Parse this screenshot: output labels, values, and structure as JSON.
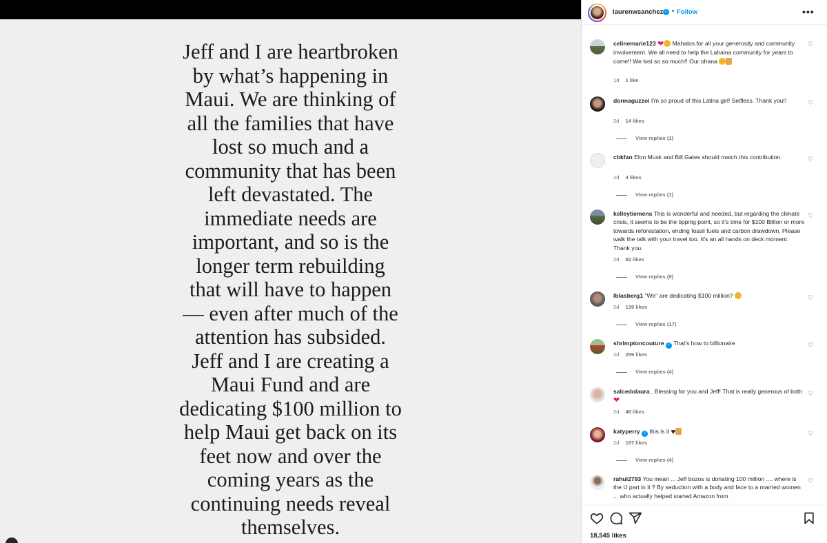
{
  "media": {
    "lines": [
      "Jeff and I are heartbroken",
      "by what’s happening in",
      "Maui. We are thinking of",
      "all the families that have",
      "lost so much and a",
      "community that has been",
      "left devastated. The",
      "immediate needs are",
      "important, and so is the",
      "longer term rebuilding",
      "that will have to happen",
      "— even after much of the",
      "attention has subsided.",
      "Jeff and I are creating a",
      "Maui Fund and are",
      "dedicating $100 million to",
      "help Maui get back on its",
      "feet now and over the",
      "coming years as the",
      "continuing needs reveal",
      "themselves."
    ]
  },
  "header": {
    "username": "laurenwsanchez",
    "dot": "•",
    "follow_label": "Follow",
    "more_label": "•••"
  },
  "comments": [
    {
      "user": "celinemarie123",
      "text": "Mahalos for all your generosity and community involvement. We all need to help the Lahaina community for years to come!! We lost so so much!! Our ohana",
      "age": "1d",
      "likes": "1 like",
      "replies": ""
    },
    {
      "user": "donnaguzzoi",
      "text": "I'm so proud of this Latina girl! Selfless. Thank you!!",
      "age": "2d",
      "likes": "14 likes",
      "replies": "View replies (1)"
    },
    {
      "user": "cbkfan",
      "text": "Elon Musk and Bill Gates should match this contribution.",
      "age": "2d",
      "likes": "4 likes",
      "replies": "View replies (1)"
    },
    {
      "user": "kelleytiemens",
      "text": "This is wonderful and needed, but regarding the climate crisis, it seems to be the tipping point, so it's time for $100 Billion or more towards reforestation, ending fossil fuels and carbon drawdown. Please walk the talk with your travel too. It's an all hands on deck moment. Thank you.",
      "age": "2d",
      "likes": "82 likes",
      "replies": "View replies (9)"
    },
    {
      "user": "lblasberg1",
      "text": "\"We\" are dedicating $100 million?",
      "age": "2d",
      "likes": "139 likes",
      "replies": "View replies (17)"
    },
    {
      "user": "shrimptoncouture",
      "text": "That's how to billionaire",
      "age": "2d",
      "likes": "259 likes",
      "replies": "View replies (4)"
    },
    {
      "user": "salcedolaura_",
      "text": "Blessing for you and Jeff! That is really generous of both",
      "age": "2d",
      "likes": "48 likes",
      "replies": ""
    },
    {
      "user": "katyperry",
      "text": "this is it",
      "age": "2d",
      "likes": "167 likes",
      "replies": "View replies (4)"
    },
    {
      "user": "rahul2793",
      "text": "You mean ... Jeff bozos is donating 100 million .... where is the U part in it ? By seduction with a body and face to a married women ... who actually helped started Amazon from",
      "age": "",
      "likes": "",
      "replies": ""
    }
  ],
  "footer": {
    "likes_label": "18,545 likes"
  },
  "icons": {
    "heart": "heart-icon",
    "comment": "comment-icon",
    "share": "share-icon",
    "save": "bookmark-icon",
    "verified": "verified-badge-icon",
    "more": "more-options-icon"
  },
  "colors": {
    "accent": "#0095f6",
    "heart_emoji": "#e0245e",
    "media_bg": "#efefef"
  }
}
